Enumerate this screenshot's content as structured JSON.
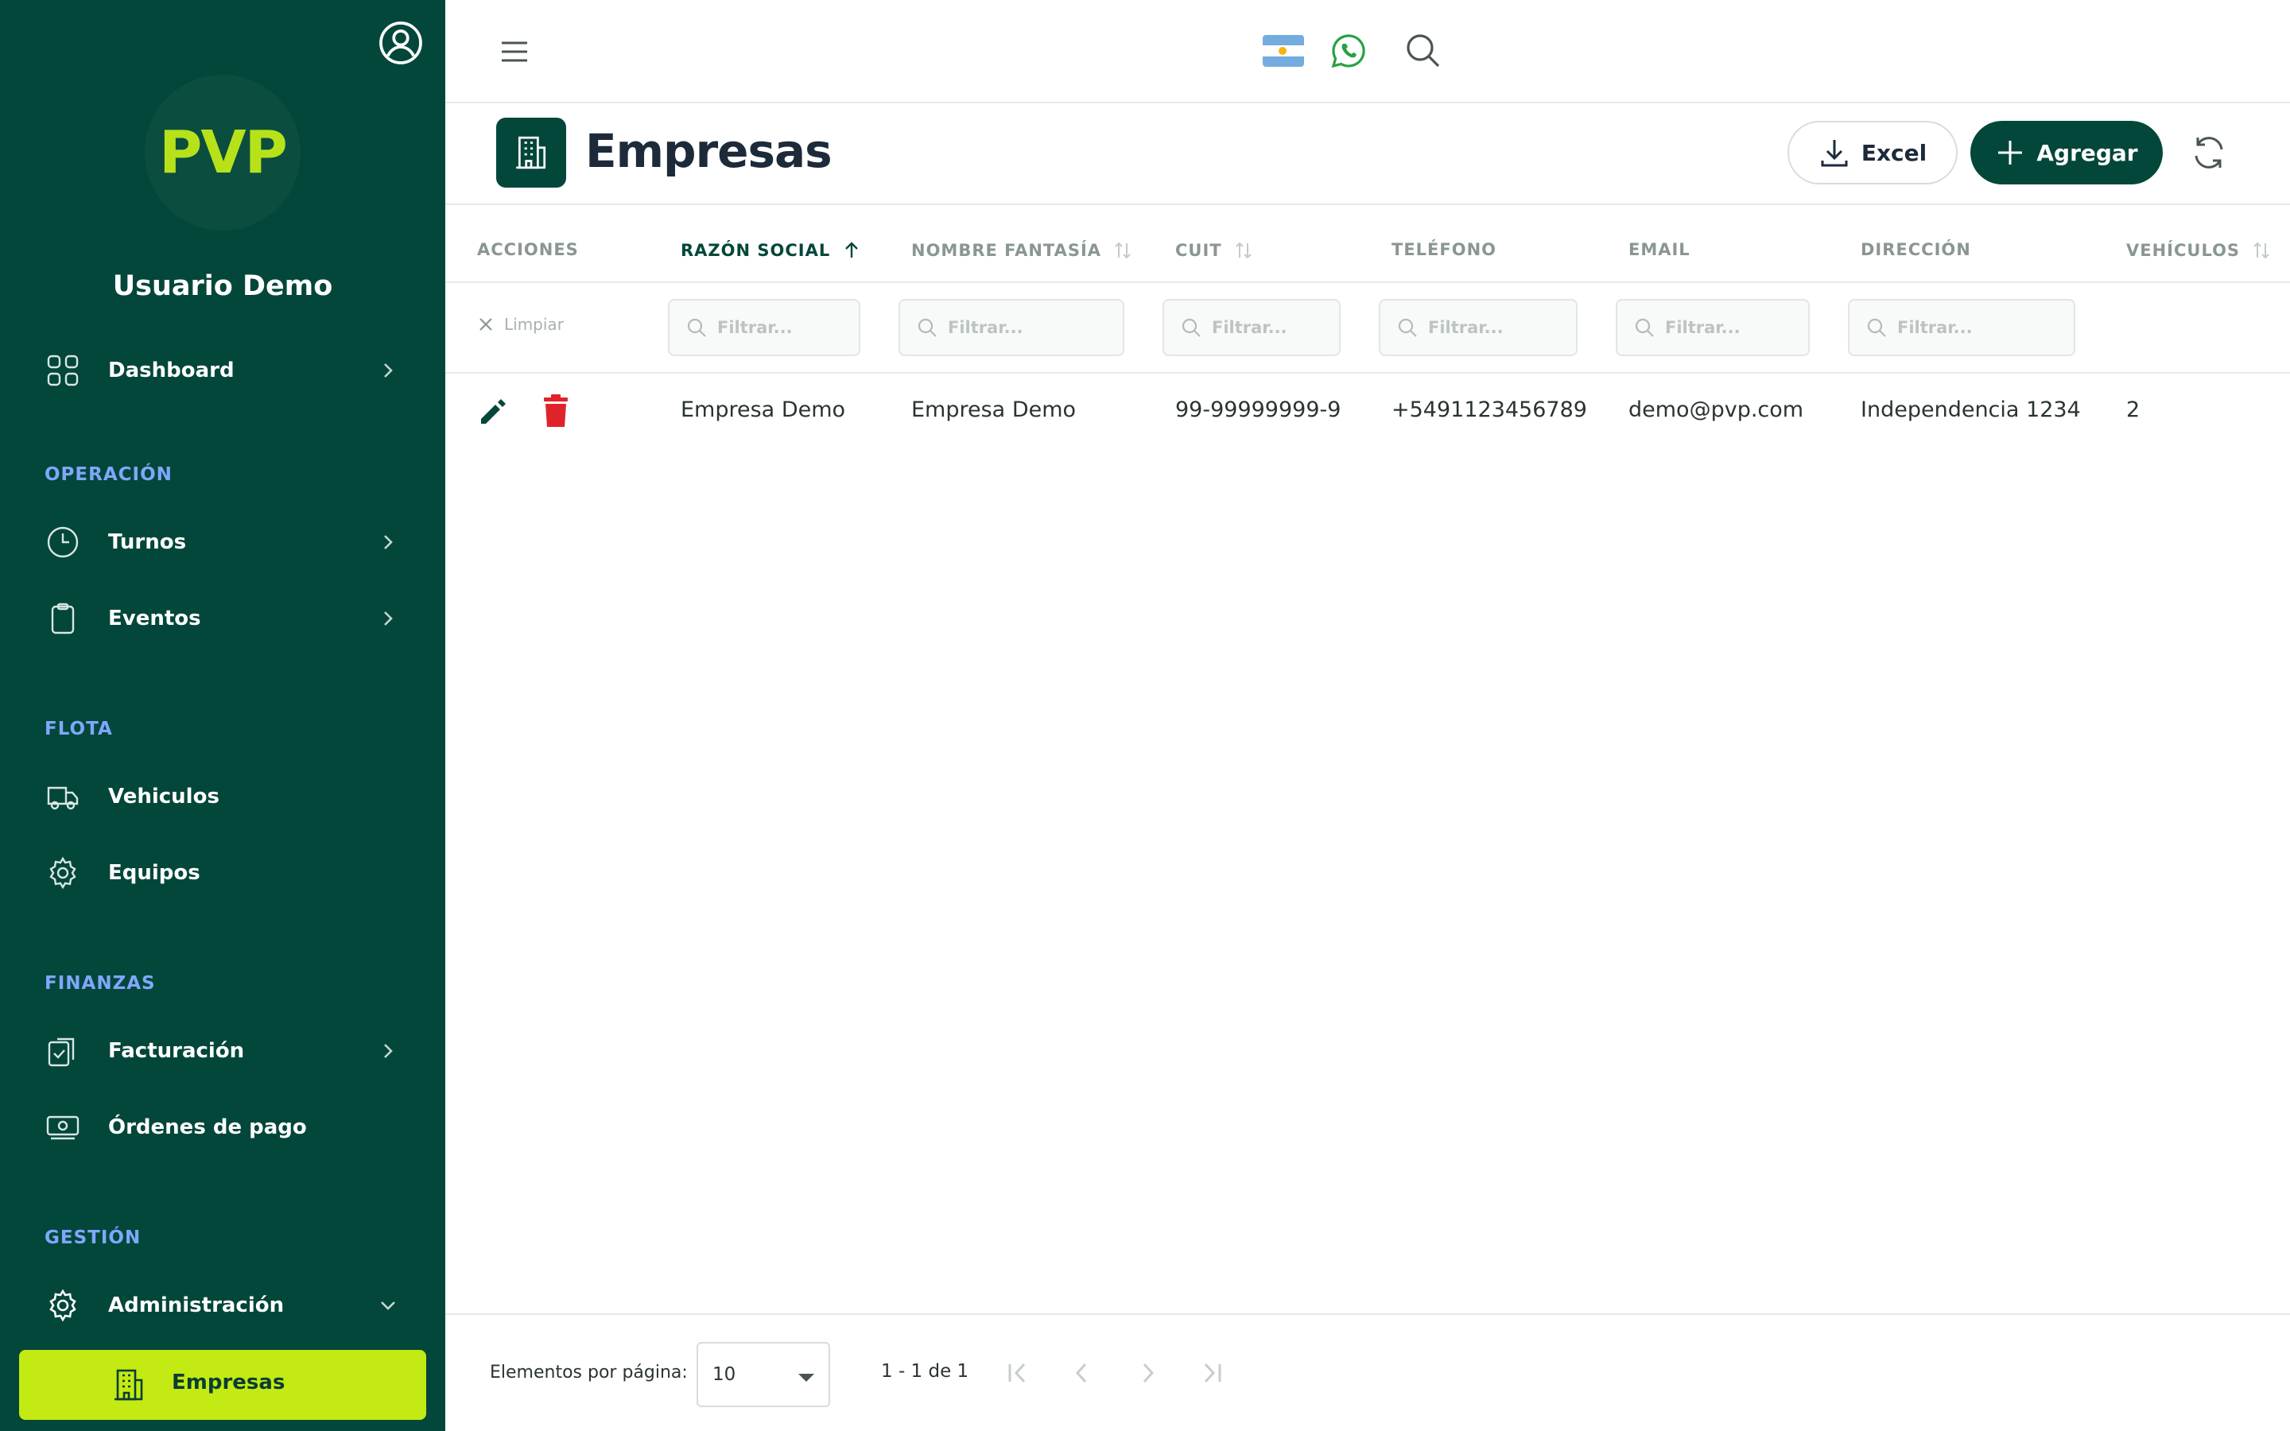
{
  "sidebar": {
    "logo_text": "PVP",
    "user_name": "Usuario Demo",
    "dashboard": {
      "label": "Dashboard",
      "icon": "grid-icon"
    },
    "sections": {
      "operacion": "OPERACIÓN",
      "flota": "FLOTA",
      "finanzas": "FINANZAS",
      "gestion": "GESTIÓN"
    },
    "items": {
      "turnos": {
        "label": "Turnos",
        "icon": "clock-icon"
      },
      "eventos": {
        "label": "Eventos",
        "icon": "clipboard-icon"
      },
      "vehiculos": {
        "label": "Vehiculos",
        "icon": "truck-icon"
      },
      "equipos": {
        "label": "Equipos",
        "icon": "gear-icon"
      },
      "facturacion": {
        "label": "Facturación",
        "icon": "clipboard-check-icon"
      },
      "ordenes": {
        "label": "Órdenes de pago",
        "icon": "money-icon"
      },
      "administracion": {
        "label": "Administración",
        "icon": "gear-icon"
      },
      "empresas": {
        "label": "Empresas",
        "icon": "building-icon"
      }
    }
  },
  "topbar": {
    "icons": [
      "menu-icon",
      "argentina-flag-icon",
      "whatsapp-icon",
      "search-icon"
    ]
  },
  "page": {
    "title": "Empresas",
    "excel_label": "Excel",
    "add_label": "Agregar"
  },
  "table": {
    "columns": [
      "ACCIONES",
      "RAZÓN SOCIAL",
      "NOMBRE FANTASÍA",
      "CUIT",
      "TELÉFONO",
      "EMAIL",
      "DIRECCIÓN",
      "VEHÍCULOS"
    ],
    "clear_label": "Limpiar",
    "filter_placeholder": "Filtrar...",
    "rows": [
      [
        "Empresa Demo",
        "Empresa Demo",
        "99-99999999-9",
        "+5491123456789",
        "demo@pvp.com",
        "Independencia 1234",
        "2"
      ]
    ]
  },
  "paginator": {
    "label": "Elementos por página:",
    "page_size": "10",
    "range": "1 - 1 de 1"
  },
  "colors": {
    "sidebar_bg": "#03473a",
    "accent": "#c3ea12",
    "section_label": "#7fa7ff",
    "delete": "#e0232b"
  }
}
